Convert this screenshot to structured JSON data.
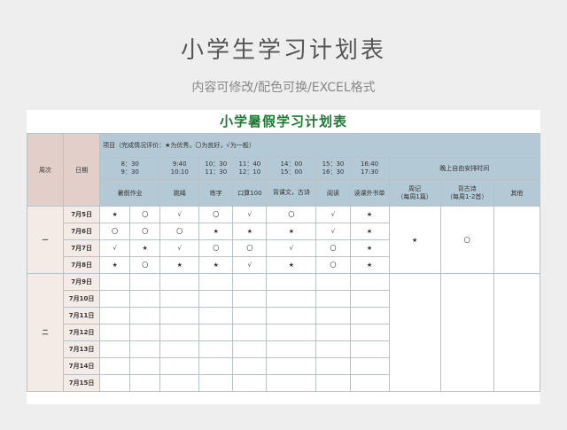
{
  "page": {
    "heading": "小学生学习计划表",
    "subheading": "内容可修改/配色可换/EXCEL格式"
  },
  "sheet": {
    "title": "小学暑假学习计划表",
    "week_header": "周次",
    "date_header": "日期",
    "legend": "项目（完成情况评价：★为优秀，〇为良好，√为一般）",
    "times": [
      {
        "start": "8：30",
        "end": "9：30"
      },
      {
        "start": "9:40",
        "end": "10:10"
      },
      {
        "start": "10：30",
        "end": "11：30"
      },
      {
        "start": "11：40",
        "end": "12：10"
      },
      {
        "start": "14：00",
        "end": "15：00"
      },
      {
        "start": "15：30",
        "end": "16：30"
      },
      {
        "start": "16:40",
        "end": "17:30"
      }
    ],
    "evening_header": "晚上自由安排时间",
    "subjects": [
      "暑假作业",
      "跳绳",
      "练字",
      "口算100",
      "背课文，古诗",
      "阅读",
      "读课外书单"
    ],
    "evening_items": [
      {
        "name": "周记",
        "note": "（每周1篇）"
      },
      {
        "name": "背古诗",
        "note": "（每周1-2首）"
      },
      {
        "name": "其他",
        "note": ""
      }
    ],
    "weeks": [
      {
        "label": "一",
        "weekly_marks": [
          "★",
          "〇",
          ""
        ],
        "days": [
          {
            "date": "7月5日",
            "marks": [
              "★",
              "〇",
              "√",
              "〇",
              "√",
              "〇",
              "√",
              "★"
            ]
          },
          {
            "date": "7月6日",
            "marks": [
              "〇",
              "〇",
              "〇",
              "★",
              "★",
              "★",
              "√",
              "★"
            ]
          },
          {
            "date": "7月7日",
            "marks": [
              "√",
              "★",
              "√",
              "〇",
              "〇",
              "√",
              "〇",
              "★"
            ]
          },
          {
            "date": "7月8日",
            "marks": [
              "★",
              "〇",
              "★",
              "★",
              "√",
              "★",
              "〇",
              "★"
            ]
          }
        ]
      },
      {
        "label": "二",
        "weekly_marks": [
          "",
          "",
          ""
        ],
        "days": [
          {
            "date": "7月9日",
            "marks": [
              "",
              "",
              "",
              "",
              "",
              "",
              "",
              ""
            ]
          },
          {
            "date": "7月10日",
            "marks": [
              "",
              "",
              "",
              "",
              "",
              "",
              "",
              ""
            ]
          },
          {
            "date": "7月11日",
            "marks": [
              "",
              "",
              "",
              "",
              "",
              "",
              "",
              ""
            ]
          },
          {
            "date": "7月12日",
            "marks": [
              "",
              "",
              "",
              "",
              "",
              "",
              "",
              ""
            ]
          },
          {
            "date": "7月13日",
            "marks": [
              "",
              "",
              "",
              "",
              "",
              "",
              "",
              ""
            ]
          },
          {
            "date": "7月14日",
            "marks": [
              "",
              "",
              "",
              "",
              "",
              "",
              "",
              ""
            ]
          },
          {
            "date": "7月15日",
            "marks": [
              "",
              "",
              "",
              "",
              "",
              "",
              "",
              ""
            ]
          }
        ]
      }
    ]
  }
}
